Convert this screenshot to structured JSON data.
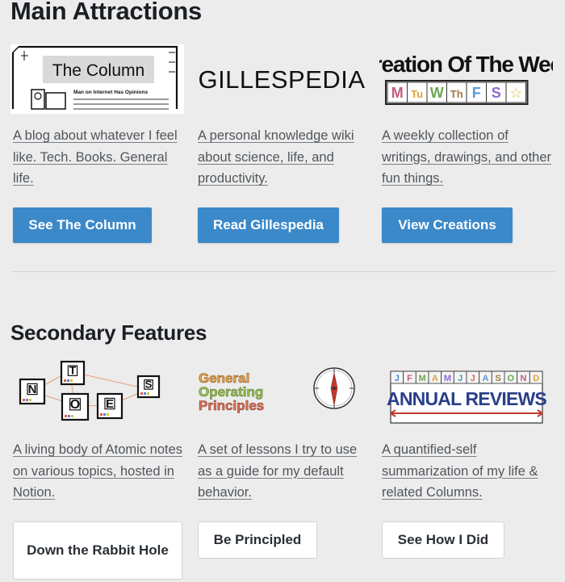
{
  "main_section": {
    "title": "Main Attractions",
    "cards": [
      {
        "image_name": "the-column-logo",
        "image_title": "The Column",
        "image_subtitle": "Man on Internet Has Opinions",
        "description": "A blog about whatever I feel like. Tech. Books. General life.",
        "button_label": "See The Column"
      },
      {
        "image_name": "gillespedia-logo",
        "image_title": "GILLESPEDIA",
        "description": "A personal knowledge wiki about science, life, and productivity.",
        "button_label": "Read Gillespedia"
      },
      {
        "image_name": "creation-of-the-week-logo",
        "image_title": "Creation Of The Week",
        "image_days": [
          "M",
          "Tu",
          "W",
          "Th",
          "F",
          "S",
          "☆"
        ],
        "description": "A weekly collection of writings, drawings, and other fun things.",
        "button_label": "View Creations"
      }
    ]
  },
  "secondary_section": {
    "title": "Secondary Features",
    "cards": [
      {
        "image_name": "atomic-notes-logo",
        "image_letters": [
          "N",
          "T",
          "O",
          "E",
          "S"
        ],
        "description": "A living body of Atomic notes on various topics, hosted in Notion.",
        "button_label": "Down the Rabbit Hole"
      },
      {
        "image_name": "general-operating-principles-logo",
        "image_lines": [
          "General",
          "Operating",
          "Principles"
        ],
        "description": "A set of lessons I try to use as a guide for my default behavior.",
        "button_label": "Be Principled"
      },
      {
        "image_name": "annual-reviews-logo",
        "image_months": [
          "J",
          "F",
          "M",
          "A",
          "M",
          "J",
          "J",
          "A",
          "S",
          "O",
          "N",
          "D"
        ],
        "image_title": "ANNUAL REVIEWS",
        "description": "A quantified-self summarization of my life & related Columns.",
        "button_label": "See How I Did"
      }
    ]
  },
  "colors": {
    "background": "#ececec",
    "primary_button": "#3b89c9",
    "secondary_button": "#ffffff",
    "link_text": "#50565c"
  }
}
